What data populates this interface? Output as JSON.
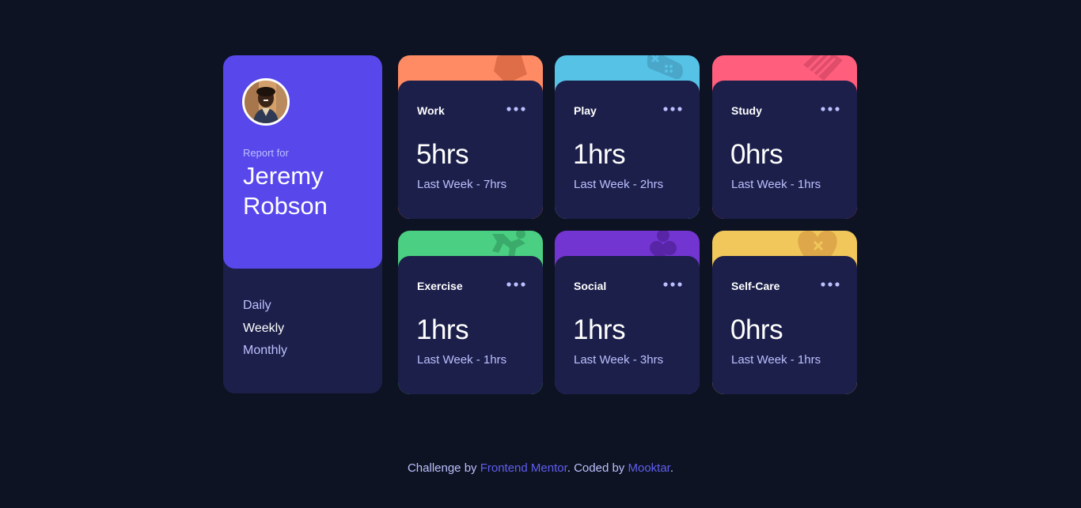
{
  "profile": {
    "report_for": "Report for",
    "name": "Jeremy Robson",
    "periods": [
      "Daily",
      "Weekly",
      "Monthly"
    ],
    "active_period": "Weekly"
  },
  "cards": [
    {
      "title": "Work",
      "hours": "5hrs",
      "previous": "Last Week - 7hrs",
      "color": "#ff8b64",
      "icon": "work-icon"
    },
    {
      "title": "Play",
      "hours": "1hrs",
      "previous": "Last Week - 2hrs",
      "color": "#55c2e6",
      "icon": "play-icon"
    },
    {
      "title": "Study",
      "hours": "0hrs",
      "previous": "Last Week - 1hrs",
      "color": "#ff5e7d",
      "icon": "study-icon"
    },
    {
      "title": "Exercise",
      "hours": "1hrs",
      "previous": "Last Week - 1hrs",
      "color": "#4bcf82",
      "icon": "exercise-icon"
    },
    {
      "title": "Social",
      "hours": "1hrs",
      "previous": "Last Week - 3hrs",
      "color": "#7335d2",
      "icon": "social-icon"
    },
    {
      "title": "Self-Care",
      "hours": "0hrs",
      "previous": "Last Week - 1hrs",
      "color": "#f1c75b",
      "icon": "self-care-icon"
    }
  ],
  "footer": {
    "prefix": "Challenge by ",
    "link1": "Frontend Mentor",
    "middle": ". Coded by ",
    "link2": "Mooktar",
    "suffix": "."
  },
  "colors": {
    "background": "#0e1323",
    "card": "#1c1f4a",
    "accent": "#5847eb",
    "muted_text": "#bbc0ff",
    "link": "#5f5ef0"
  }
}
